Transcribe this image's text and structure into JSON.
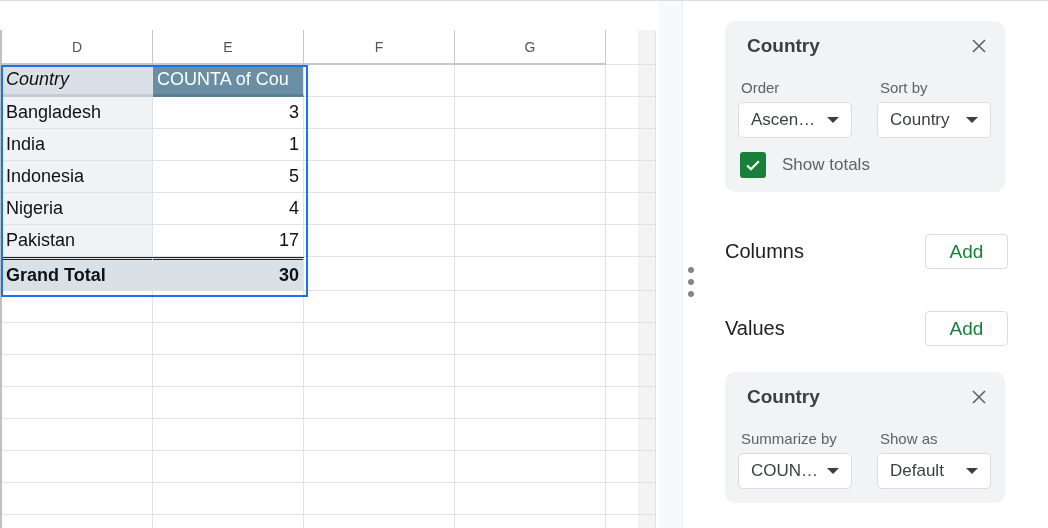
{
  "sheet": {
    "columns": [
      "D",
      "E",
      "F",
      "G"
    ],
    "pivot": {
      "header": [
        "Country",
        "COUNTA of Cou"
      ],
      "rows": [
        {
          "label": "Bangladesh",
          "value": "3"
        },
        {
          "label": "India",
          "value": "1"
        },
        {
          "label": "Indonesia",
          "value": "5"
        },
        {
          "label": "Nigeria",
          "value": "4"
        },
        {
          "label": "Pakistan",
          "value": "17"
        }
      ],
      "total": {
        "label": "Grand Total",
        "value": "30"
      }
    }
  },
  "editor": {
    "row_group": {
      "title": "Country",
      "fields": [
        {
          "label": "Order",
          "value": "Ascen…"
        },
        {
          "label": "Sort by",
          "value": "Country"
        }
      ],
      "show_totals": {
        "label": "Show totals",
        "checked": true
      }
    },
    "sections": [
      {
        "label": "Columns",
        "button": "Add"
      },
      {
        "label": "Values",
        "button": "Add"
      }
    ],
    "value_card": {
      "title": "Country",
      "fields": [
        {
          "label": "Summarize by",
          "value": "COUN…"
        },
        {
          "label": "Show as",
          "value": "Default"
        }
      ]
    }
  }
}
